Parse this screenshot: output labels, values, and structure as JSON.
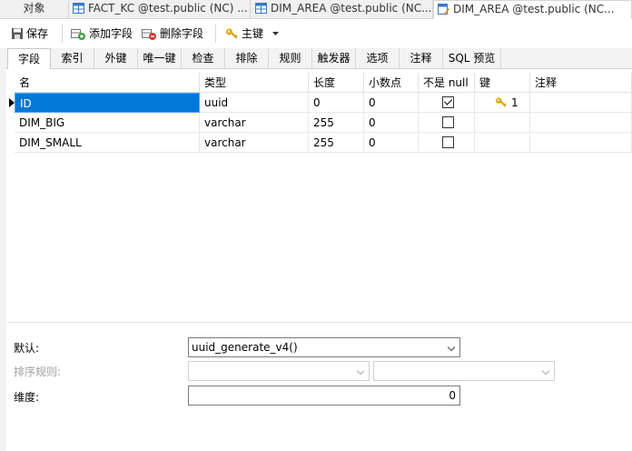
{
  "tabs": [
    {
      "label": "对象"
    },
    {
      "label": "FACT_KC @test.public (NC) ..."
    },
    {
      "label": "DIM_AREA @test.public (NC..."
    },
    {
      "label": "DIM_AREA @test.public (NC..."
    }
  ],
  "toolbar": {
    "save": "保存",
    "add_field": "添加字段",
    "delete_field": "删除字段",
    "primary_key": "主键"
  },
  "subtabs": [
    "字段",
    "索引",
    "外键",
    "唯一键",
    "检查",
    "排除",
    "规则",
    "触发器",
    "选项",
    "注释",
    "SQL 预览"
  ],
  "columns": [
    "名",
    "类型",
    "长度",
    "小数点",
    "不是 null",
    "键",
    "注释"
  ],
  "rows": [
    {
      "name": "ID",
      "type": "uuid",
      "length": "0",
      "decimals": "0",
      "not_null": true,
      "key": "1"
    },
    {
      "name": "DIM_BIG",
      "type": "varchar",
      "length": "255",
      "decimals": "0",
      "not_null": false,
      "key": ""
    },
    {
      "name": "DIM_SMALL",
      "type": "varchar",
      "length": "255",
      "decimals": "0",
      "not_null": false,
      "key": ""
    }
  ],
  "props": {
    "default_label": "默认:",
    "default_value": "uuid_generate_v4()",
    "collation_label": "排序规则:",
    "dimension_label": "维度:",
    "dimension_value": "0"
  },
  "colors": {
    "selection": "#0078d7",
    "key_gold": "#d4a017"
  }
}
